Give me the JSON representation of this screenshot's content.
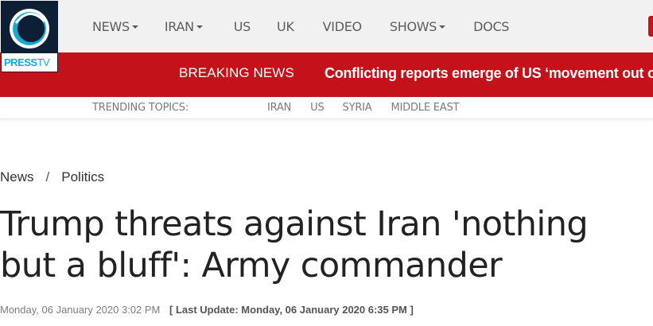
{
  "brand": {
    "logo_text_press": "PRESS",
    "logo_text_tv": "TV",
    "accent_red": "#c4121a",
    "navy": "#0d1f35",
    "cyan": "#19a8d1"
  },
  "nav": {
    "items": [
      {
        "label": "NEWS",
        "dropdown": true
      },
      {
        "label": "IRAN",
        "dropdown": true
      },
      {
        "label": "US",
        "dropdown": false
      },
      {
        "label": "UK",
        "dropdown": false
      },
      {
        "label": "VIDEO",
        "dropdown": false
      },
      {
        "label": "SHOWS",
        "dropdown": true
      },
      {
        "label": "DOCS",
        "dropdown": false
      }
    ]
  },
  "breaking": {
    "label": "BREAKING NEWS",
    "headline": "Conflicting reports emerge of US ‘movement out of Iraq’"
  },
  "trending": {
    "label": "TRENDING TOPICS:",
    "topics": [
      "IRAN",
      "US",
      "SYRIA",
      "MIDDLE EAST"
    ]
  },
  "breadcrumb": {
    "items": [
      "News",
      "Politics"
    ],
    "separator": "/"
  },
  "article": {
    "title": "Trump threats against Iran 'nothing but a bluff': Army commander",
    "published": "Monday, 06 January 2020 3:02 PM",
    "last_update": "[ Last Update: Monday, 06 January 2020 6:35 PM ]"
  }
}
